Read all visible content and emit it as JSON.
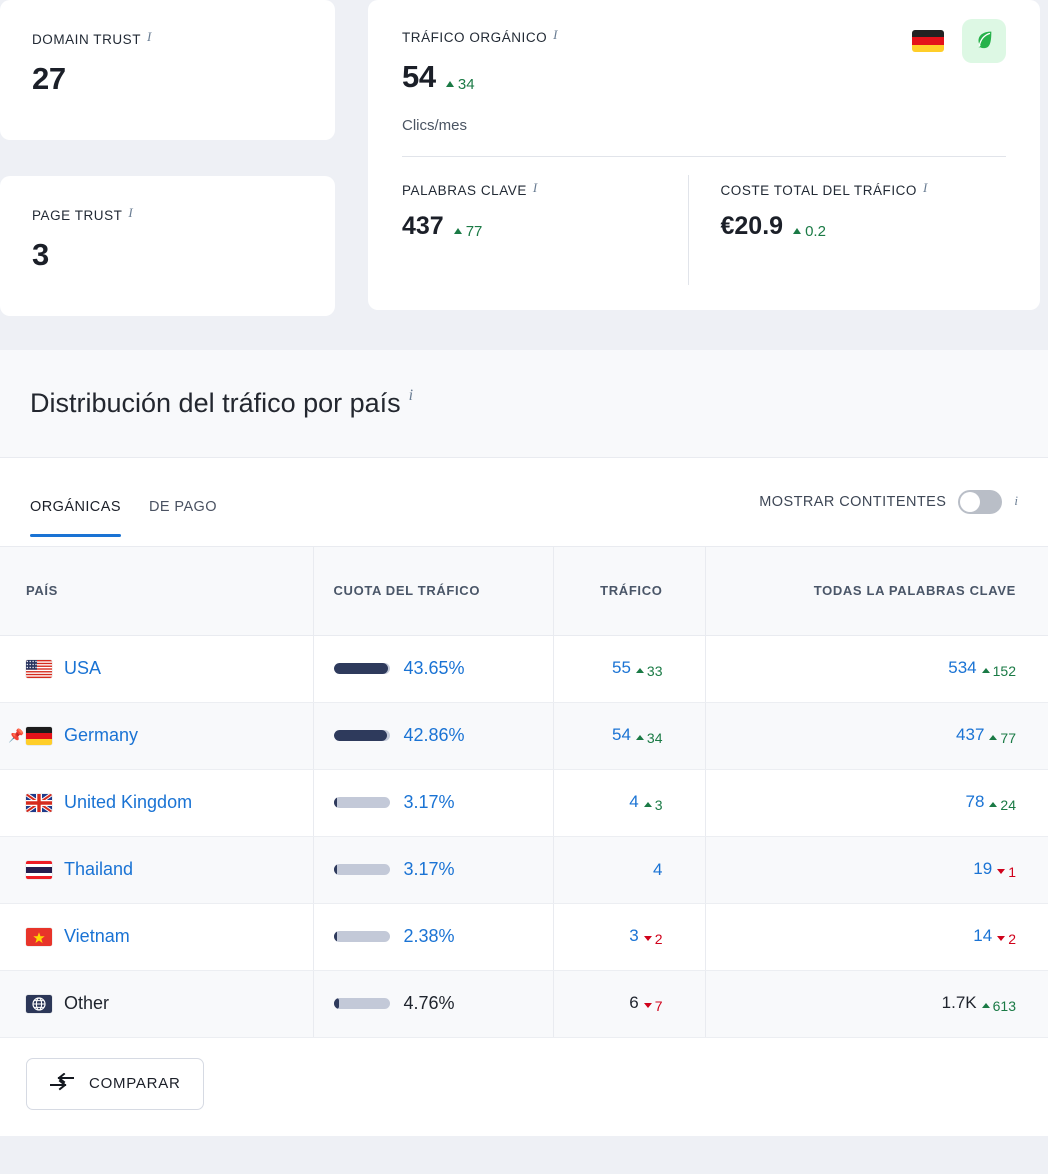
{
  "cards": {
    "domain_trust": {
      "label": "DOMAIN TRUST",
      "value": "27",
      "accent": "#f4b8cb",
      "info": "i"
    },
    "page_trust": {
      "label": "PAGE TRUST",
      "value": "3",
      "accent": "#f0d9a3",
      "info": "i"
    },
    "organic_traffic": {
      "label": "TRÁFICO ORGÁNICO",
      "value": "54",
      "delta": "34",
      "delta_dir": "up",
      "sub_label": "Clics/mes",
      "accent": "#b6e3c6",
      "flag": "de-flag-icon",
      "badge_icon": "leaf-icon",
      "info": "i"
    },
    "keywords": {
      "label": "PALABRAS CLAVE",
      "value": "437",
      "delta": "77",
      "delta_dir": "up",
      "info": "i"
    },
    "traffic_cost": {
      "label": "COSTE TOTAL DEL TRÁFICO",
      "value": "€20.9",
      "delta": "0.2",
      "delta_dir": "up",
      "info": "i"
    }
  },
  "section": {
    "title": "Distribución del tráfico por país",
    "info": "i"
  },
  "tabs": [
    {
      "label": "ORGÁNICAS",
      "active": true
    },
    {
      "label": "DE PAGO",
      "active": false
    }
  ],
  "toggle": {
    "label": "MOSTRAR CONTITENTES",
    "checked": false,
    "info": "i"
  },
  "table": {
    "columns": [
      "PAÍS",
      "CUOTA DEL TRÁFICO",
      "TRÁFICO",
      "TODAS LA PALABRAS CLAVE"
    ],
    "rows": [
      {
        "country": "USA",
        "flag": "us-flag-icon",
        "pinned": false,
        "link": true,
        "share_pct": "43.65%",
        "share_value": 43.65,
        "traffic": "55",
        "traffic_delta": "33",
        "traffic_delta_dir": "up",
        "traffic_link": true,
        "keywords": "534",
        "keywords_delta": "152",
        "keywords_delta_dir": "up",
        "keywords_link": true
      },
      {
        "country": "Germany",
        "flag": "de-flag-icon",
        "pinned": true,
        "link": true,
        "share_pct": "42.86%",
        "share_value": 42.86,
        "traffic": "54",
        "traffic_delta": "34",
        "traffic_delta_dir": "up",
        "traffic_link": true,
        "keywords": "437",
        "keywords_delta": "77",
        "keywords_delta_dir": "up",
        "keywords_link": true
      },
      {
        "country": "United Kingdom",
        "flag": "gb-flag-icon",
        "pinned": false,
        "link": true,
        "share_pct": "3.17%",
        "share_value": 3.17,
        "traffic": "4",
        "traffic_delta": "3",
        "traffic_delta_dir": "up",
        "traffic_link": true,
        "keywords": "78",
        "keywords_delta": "24",
        "keywords_delta_dir": "up",
        "keywords_link": true
      },
      {
        "country": "Thailand",
        "flag": "th-flag-icon",
        "pinned": false,
        "link": true,
        "share_pct": "3.17%",
        "share_value": 3.17,
        "traffic": "4",
        "traffic_delta": "",
        "traffic_delta_dir": "",
        "traffic_link": true,
        "keywords": "19",
        "keywords_delta": "1",
        "keywords_delta_dir": "down",
        "keywords_link": true
      },
      {
        "country": "Vietnam",
        "flag": "vn-flag-icon",
        "pinned": false,
        "link": true,
        "share_pct": "2.38%",
        "share_value": 2.38,
        "traffic": "3",
        "traffic_delta": "2",
        "traffic_delta_dir": "down",
        "traffic_link": true,
        "keywords": "14",
        "keywords_delta": "2",
        "keywords_delta_dir": "down",
        "keywords_link": true
      },
      {
        "country": "Other",
        "flag": "globe-icon",
        "pinned": false,
        "link": false,
        "share_pct": "4.76%",
        "share_value": 4.76,
        "traffic": "6",
        "traffic_delta": "7",
        "traffic_delta_dir": "down",
        "traffic_link": false,
        "keywords": "1.7K",
        "keywords_delta": "613",
        "keywords_delta_dir": "up",
        "keywords_link": false
      }
    ]
  },
  "footer": {
    "compare_label": "COMPARAR",
    "compare_icon": "compare-arrows-icon"
  },
  "chart_data": {
    "type": "bar",
    "title": "Distribución del tráfico por país",
    "categories": [
      "USA",
      "Germany",
      "United Kingdom",
      "Thailand",
      "Vietnam",
      "Other"
    ],
    "series": [
      {
        "name": "Cuota del tráfico (%)",
        "values": [
          43.65,
          42.86,
          3.17,
          3.17,
          2.38,
          4.76
        ]
      },
      {
        "name": "Tráfico",
        "values": [
          55,
          54,
          4,
          4,
          3,
          6
        ]
      },
      {
        "name": "Todas la palabras clave",
        "values": [
          534,
          437,
          78,
          19,
          14,
          1700
        ]
      }
    ],
    "xlabel": "País",
    "ylabel": "Cuota del tráfico",
    "ylim": [
      0,
      100
    ],
    "legend": "none",
    "grid": false
  },
  "colors": {
    "link_blue": "#1a73d4",
    "up_green": "#1a7a45",
    "down_red": "#d0021b",
    "bar_fill": "#2e3a5c",
    "bar_track": "#c3c9d8",
    "tab_underline": "#1a73d4"
  }
}
